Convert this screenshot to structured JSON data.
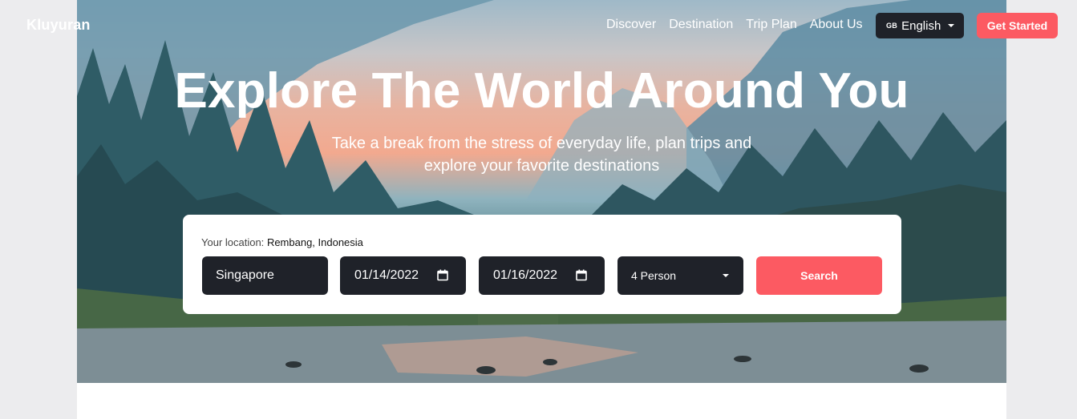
{
  "header": {
    "brand": "Kluyuran",
    "nav": [
      "Discover",
      "Destination",
      "Trip Plan",
      "About Us"
    ],
    "language": {
      "flag": "GB",
      "label": "English"
    },
    "cta_label": "Get Started"
  },
  "hero": {
    "title": "Explore The World Around You",
    "subtitle_line1": "Take a break from the stress of everyday life, plan trips and",
    "subtitle_line2": "explore your favorite destinations"
  },
  "search": {
    "location_label": "Your location:",
    "location_value": "Rembang, Indonesia",
    "destination": "Singapore",
    "check_in": "01/14/2022",
    "check_out": "01/16/2022",
    "guests": "4 Person",
    "button_label": "Search"
  },
  "colors": {
    "accent": "#fc5a62",
    "field_bg": "#1f2229"
  }
}
